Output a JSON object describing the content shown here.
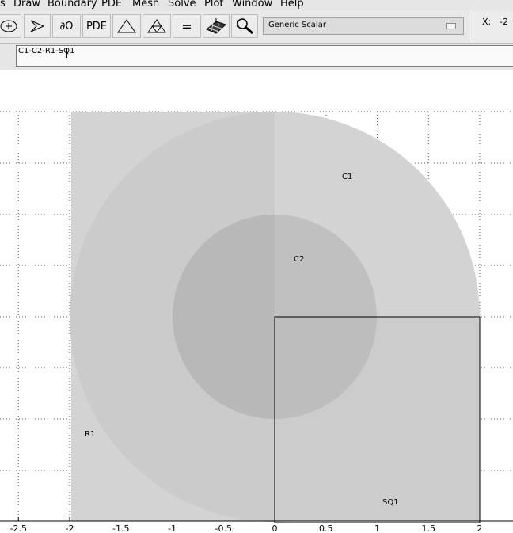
{
  "menu": {
    "items": [
      {
        "label": "s",
        "accel": ""
      },
      {
        "label": "Draw",
        "accel": "D"
      },
      {
        "label": "Boundary",
        "accel": "B"
      },
      {
        "label": "PDE",
        "accel": "P"
      },
      {
        "label": "Mesh",
        "accel": "M"
      },
      {
        "label": "Solve",
        "accel": "S"
      },
      {
        "label": "Plot",
        "accel": "P"
      },
      {
        "label": "Window",
        "accel": "W"
      },
      {
        "label": "Help",
        "accel": "H"
      }
    ]
  },
  "toolbar": {
    "buttons": [
      {
        "name": "ellipse-centered-tool",
        "icon": "ellipse-plus-icon"
      },
      {
        "name": "polygon-tool",
        "icon": "polygon-icon"
      },
      {
        "name": "boundary-mode-button",
        "icon": "boundary-icon",
        "text": "∂Ω"
      },
      {
        "name": "pde-spec-button",
        "icon": "",
        "text": "PDE"
      },
      {
        "name": "init-mesh-button",
        "icon": "triangle-icon"
      },
      {
        "name": "refine-mesh-button",
        "icon": "refined-triangle-icon"
      },
      {
        "name": "solve-button",
        "icon": "equals-icon",
        "text": "="
      },
      {
        "name": "plot-solution-button",
        "icon": "surface-plot-icon"
      },
      {
        "name": "zoom-button",
        "icon": "magnifier-icon"
      }
    ],
    "application_mode": "Generic Scalar",
    "coord_label": "X:",
    "coord_value": "-2"
  },
  "set_formula": {
    "value": "C1-C2-R1-SQ1"
  },
  "plot": {
    "x_ticks": [
      "-2.5",
      "-2",
      "-1.5",
      "-1",
      "-0.5",
      "0",
      "0.5",
      "1",
      "1.5",
      "2"
    ],
    "shapes": [
      {
        "label": "C1",
        "kind": "circle"
      },
      {
        "label": "C2",
        "kind": "circle"
      },
      {
        "label": "R1",
        "kind": "rectangle"
      },
      {
        "label": "SQ1",
        "kind": "square",
        "selected": true
      }
    ],
    "colors": {
      "shape_fill": "#d3d3d3",
      "overlap_fill": "#b8b8b8",
      "grid": "#555555"
    }
  }
}
